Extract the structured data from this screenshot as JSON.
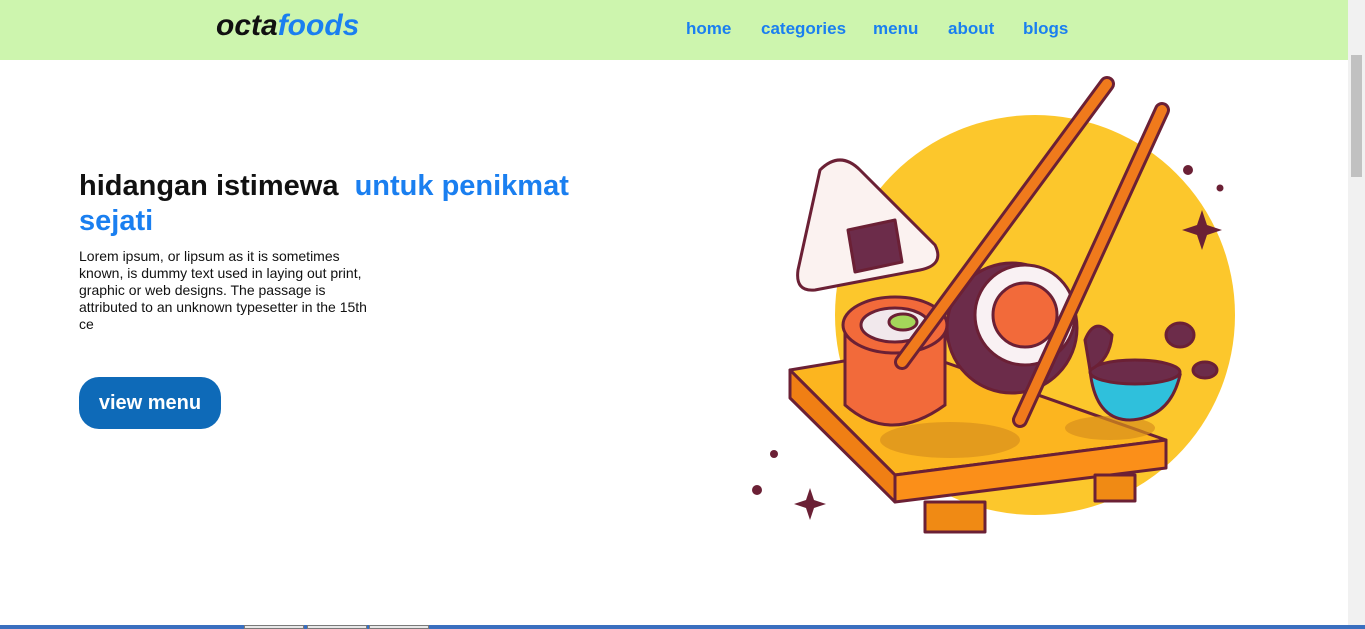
{
  "brand": {
    "part1": "octa",
    "part2": "foods"
  },
  "nav": {
    "items": [
      {
        "label": "home"
      },
      {
        "label": "categories"
      },
      {
        "label": "menu"
      },
      {
        "label": "about"
      },
      {
        "label": "blogs"
      }
    ]
  },
  "hero": {
    "title_main": "hidangan istimewa",
    "title_accent": "untuk penikmat sejati",
    "description": "Lorem ipsum, or lipsum as it is sometimes known, is dummy text used in laying out print, graphic or web designs. The passage is attributed to an unknown typesetter in the 15th ce",
    "cta_label": "view menu",
    "illustration": "sushi-illustration"
  },
  "colors": {
    "navbar_bg": "#cdf5ae",
    "accent": "#1a7ff0",
    "button": "#0e6ab8",
    "text": "#111111"
  }
}
